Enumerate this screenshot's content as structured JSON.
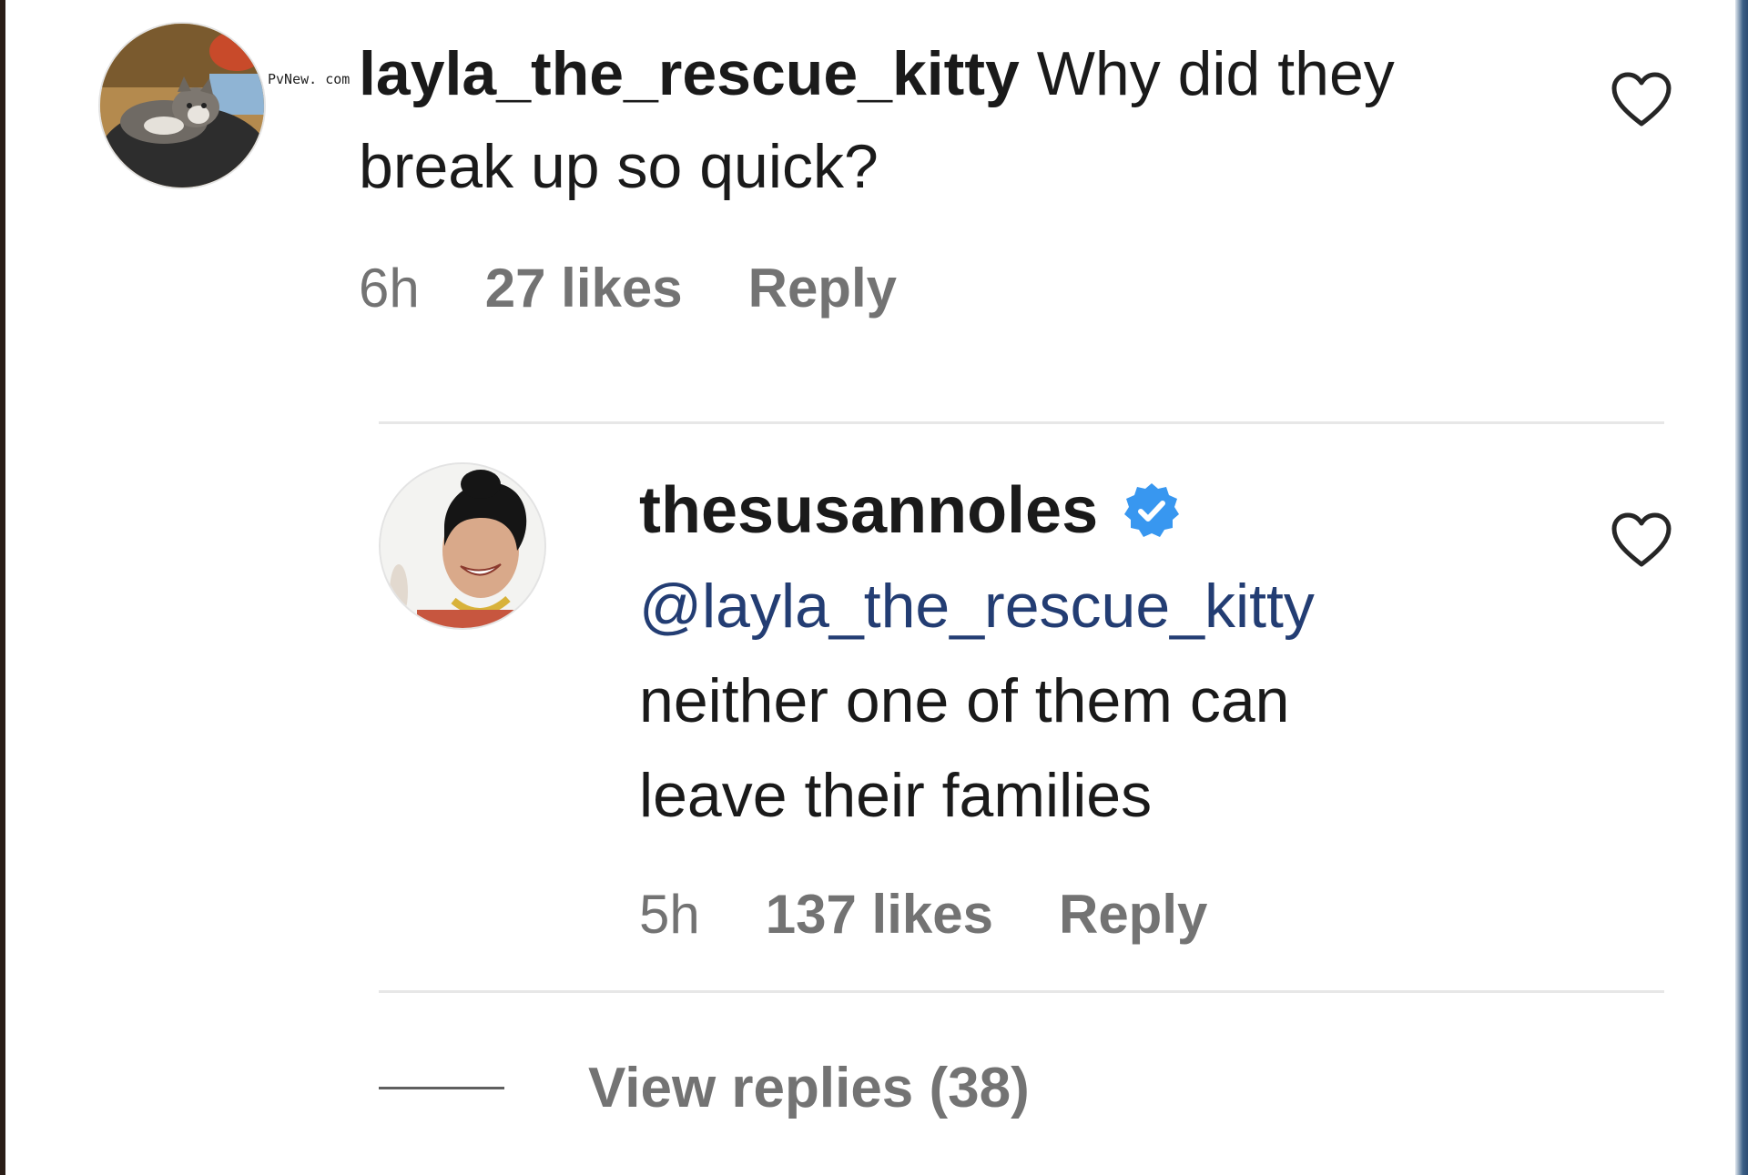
{
  "watermark": "PvNew. com",
  "comment": {
    "username": "layla_the_rescue_kitty",
    "text": "Why did they break up so quick?",
    "time": "6h",
    "likes": "27 likes",
    "reply_label": "Reply",
    "avatar_icon": "cat-profile-photo",
    "like_icon": "heart-outline-icon"
  },
  "reply": {
    "username": "thesusannoles",
    "verified_icon": "verified-badge-icon",
    "mention": "@layla_the_rescue_kitty",
    "line1": "neither one of them can",
    "line2": "leave their families",
    "time": "5h",
    "likes": "137 likes",
    "reply_label": "Reply",
    "avatar_icon": "woman-profile-photo",
    "like_icon": "heart-outline-icon"
  },
  "view_replies": {
    "label": "View replies (38)"
  },
  "colors": {
    "text": "#1a1a1a",
    "meta": "#737373",
    "mention": "#233d73",
    "verified": "#3897f0"
  }
}
